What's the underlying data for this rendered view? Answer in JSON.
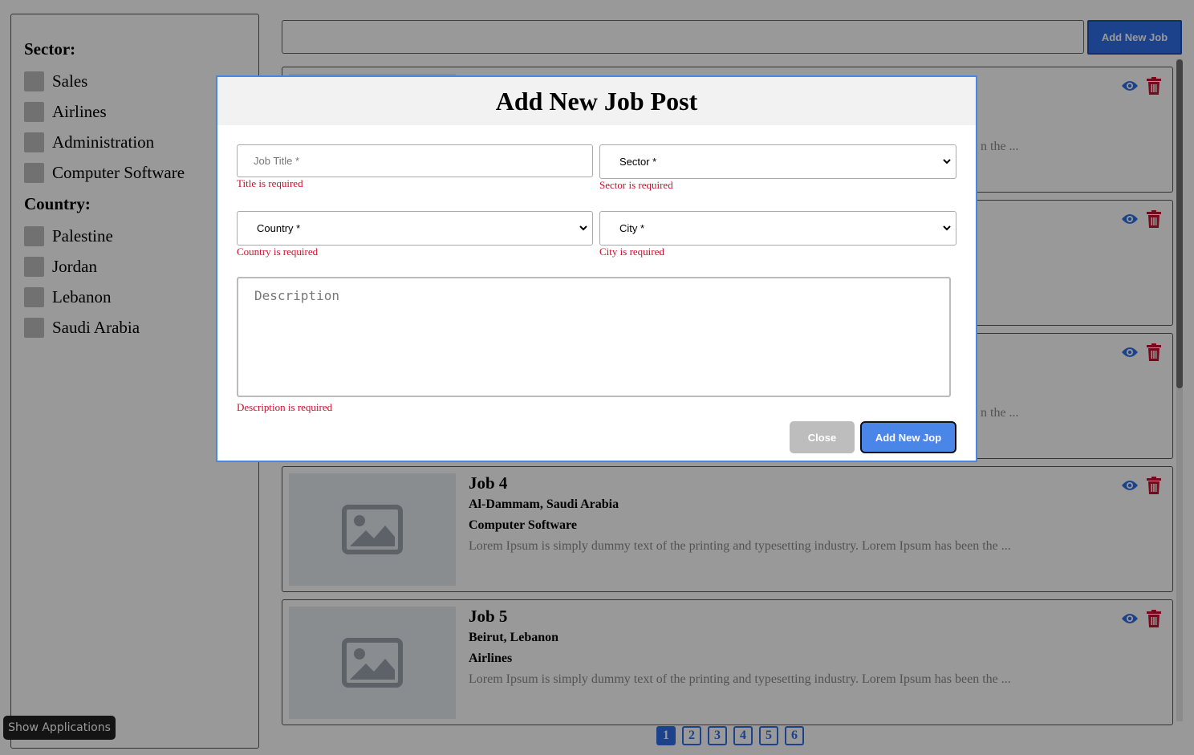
{
  "sidebar": {
    "sector_title": "Sector:",
    "sectors": [
      "Sales",
      "Airlines",
      "Administration",
      "Computer Software"
    ],
    "country_title": "Country:",
    "countries": [
      "Palestine",
      "Jordan",
      "Lebanon",
      "Saudi Arabia"
    ]
  },
  "toolbar": {
    "search_value": "",
    "add_job_label": "Add New Job"
  },
  "jobs": [
    {
      "title": "",
      "location": "",
      "sector": "",
      "desc": "n the ..."
    },
    {
      "title": "",
      "location": "",
      "sector": "",
      "desc": ""
    },
    {
      "title": "",
      "location": "",
      "sector": "",
      "desc": "n the ..."
    },
    {
      "title": "Job 4",
      "location": "Al-Dammam, Saudi Arabia",
      "sector": "Computer Software",
      "desc": "Lorem Ipsum is simply dummy text of the printing and typesetting industry. Lorem Ipsum has been the ..."
    },
    {
      "title": "Job 5",
      "location": "Beirut, Lebanon",
      "sector": "Airlines",
      "desc": "Lorem Ipsum is simply dummy text of the printing and typesetting industry. Lorem Ipsum has been the ..."
    }
  ],
  "pagination": {
    "pages": [
      "1",
      "2",
      "3",
      "4",
      "5",
      "6"
    ],
    "current": "1"
  },
  "show_applications_label": "Show Applications",
  "modal": {
    "title": "Add New Job Post",
    "job_title_placeholder": "Job Title *",
    "title_error": "Title is required",
    "sector_select": "Sector *",
    "sector_error": "Sector is required",
    "country_select": "Country *",
    "country_error": "Country is required",
    "city_select": "City *",
    "city_error": "City is required",
    "description_placeholder": "Description",
    "description_error": "Description is required",
    "close_label": "Close",
    "submit_label": "Add New Jop"
  },
  "colors": {
    "accent": "#2f6fe8",
    "danger": "#c8102e",
    "overlay": "rgba(0,0,0,0.4)"
  }
}
